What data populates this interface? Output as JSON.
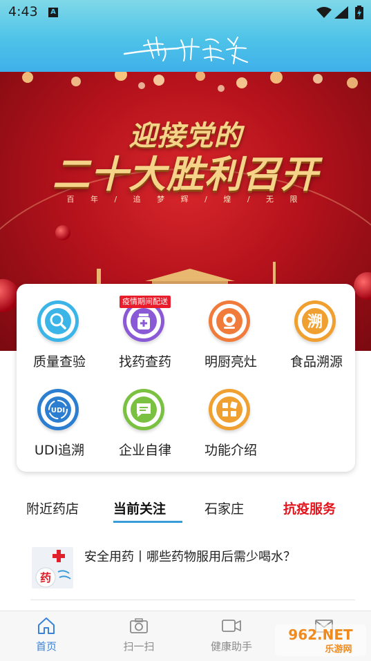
{
  "status_bar": {
    "time": "4:43",
    "sim_letter": "A"
  },
  "header": {
    "logo_text": "药安食美"
  },
  "banner": {
    "title_line1": "迎接党的",
    "title_line2": "二十大胜利召开",
    "subtitle": "百 年 / 追 梦 辉 / 煌 / 无 限"
  },
  "grid": {
    "items": [
      {
        "label": "质量查验",
        "icon": "search-icon",
        "color": "#3bb5e8"
      },
      {
        "label": "找药查药",
        "icon": "medicine-bottle-icon",
        "color": "#8a5ad6"
      },
      {
        "label": "明厨亮灶",
        "icon": "camera-icon",
        "color": "#f07b3a"
      },
      {
        "label": "食品溯源",
        "icon": "trace-icon",
        "color": "#f0a030"
      },
      {
        "label": "UDI追溯",
        "icon": "udi-icon",
        "color": "#2c7fd0"
      },
      {
        "label": "企业自律",
        "icon": "message-icon",
        "color": "#7ac142"
      },
      {
        "label": "功能介绍",
        "icon": "grid-icon",
        "color": "#f0a030"
      }
    ],
    "badge": "疫情期间配送",
    "trace_glyph": "溯",
    "udi_glyph": "UDI"
  },
  "tabs": [
    {
      "label": "附近药店"
    },
    {
      "label": "当前关注"
    },
    {
      "label": "石家庄"
    },
    {
      "label": "抗疫服务"
    }
  ],
  "article": {
    "title": "安全用药丨哪些药物服用后需少喝水？",
    "thumb_glyph": "药"
  },
  "bottom_nav": [
    {
      "label": "首页",
      "icon": "home-icon"
    },
    {
      "label": "扫一扫",
      "icon": "camera-icon"
    },
    {
      "label": "健康助手",
      "icon": "video-icon"
    },
    {
      "label": "",
      "icon": "mail-icon"
    }
  ],
  "watermark": {
    "main": "962.NET",
    "sub": "乐游网"
  },
  "colors": {
    "header": "#4ec3e8",
    "accent": "#3a82d9",
    "alert": "#e4141c"
  }
}
